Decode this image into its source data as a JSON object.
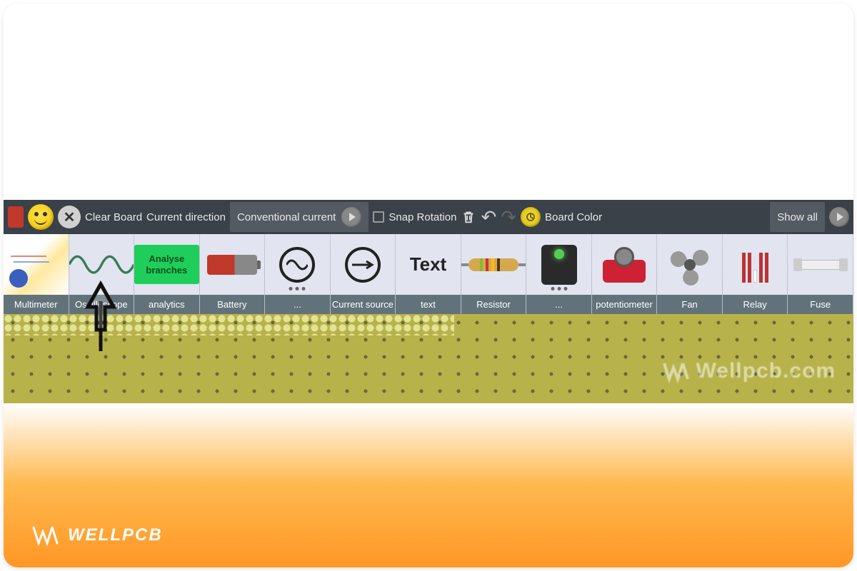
{
  "toolbar": {
    "clear_board": "Clear Board",
    "current_direction": "Current direction",
    "conventional_current": "Conventional current",
    "snap_rotation": "Snap Rotation",
    "board_color": "Board Color",
    "show_all": "Show all"
  },
  "components": [
    {
      "label": "Multimeter",
      "icon": "multimeter"
    },
    {
      "label": "Oscilloscope",
      "icon": "oscilloscope"
    },
    {
      "label": "analytics",
      "icon": "analyse",
      "btn_text": "Analyse branches"
    },
    {
      "label": "Battery",
      "icon": "battery"
    },
    {
      "label": "...",
      "icon": "ac",
      "dots": true
    },
    {
      "label": "Current source",
      "icon": "currentsource"
    },
    {
      "label": "text",
      "icon": "text",
      "text_value": "Text"
    },
    {
      "label": "Resistor",
      "icon": "resistor"
    },
    {
      "label": "...",
      "icon": "chip",
      "dots": true
    },
    {
      "label": "potentiometer",
      "icon": "potentiometer"
    },
    {
      "label": "Fan",
      "icon": "fan"
    },
    {
      "label": "Relay",
      "icon": "relay"
    },
    {
      "label": "Fuse",
      "icon": "fuse"
    }
  ],
  "watermark": "Wellpcb.com",
  "brand": "WELLPCB"
}
